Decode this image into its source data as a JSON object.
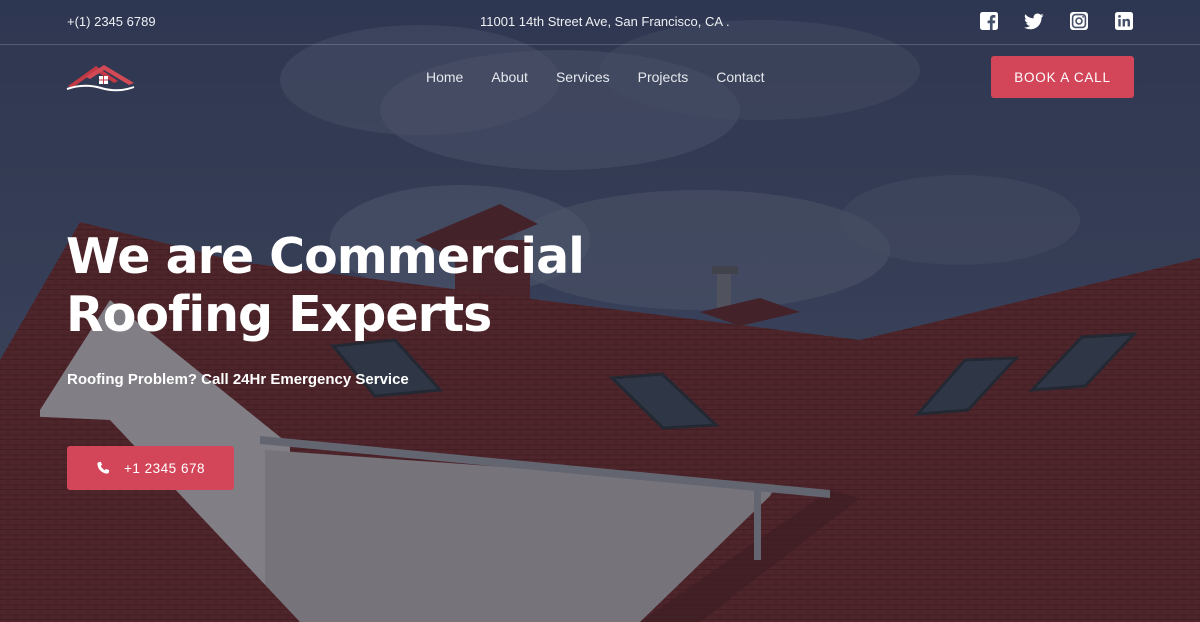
{
  "topbar": {
    "phone": "+(1) 2345 6789",
    "address": "11001 14th Street Ave, San Francisco, CA .",
    "socials": [
      "facebook-icon",
      "twitter-icon",
      "instagram-icon",
      "linkedin-icon"
    ]
  },
  "nav": {
    "logo_icon": "house-roof-logo",
    "menu": [
      "Home",
      "About",
      "Services",
      "Projects",
      "Contact"
    ],
    "cta_label": "BOOK A CALL"
  },
  "hero": {
    "heading_line1": "We are Commercial",
    "heading_line2": "Roofing Experts",
    "subheading": "Roofing Problem? Call 24Hr Emergency Service",
    "call_icon": "phone-icon",
    "call_label": "+1 2345 678"
  },
  "colors": {
    "accent": "#d3465a",
    "sky": "#46506a",
    "roof": "#6e2a2c"
  }
}
